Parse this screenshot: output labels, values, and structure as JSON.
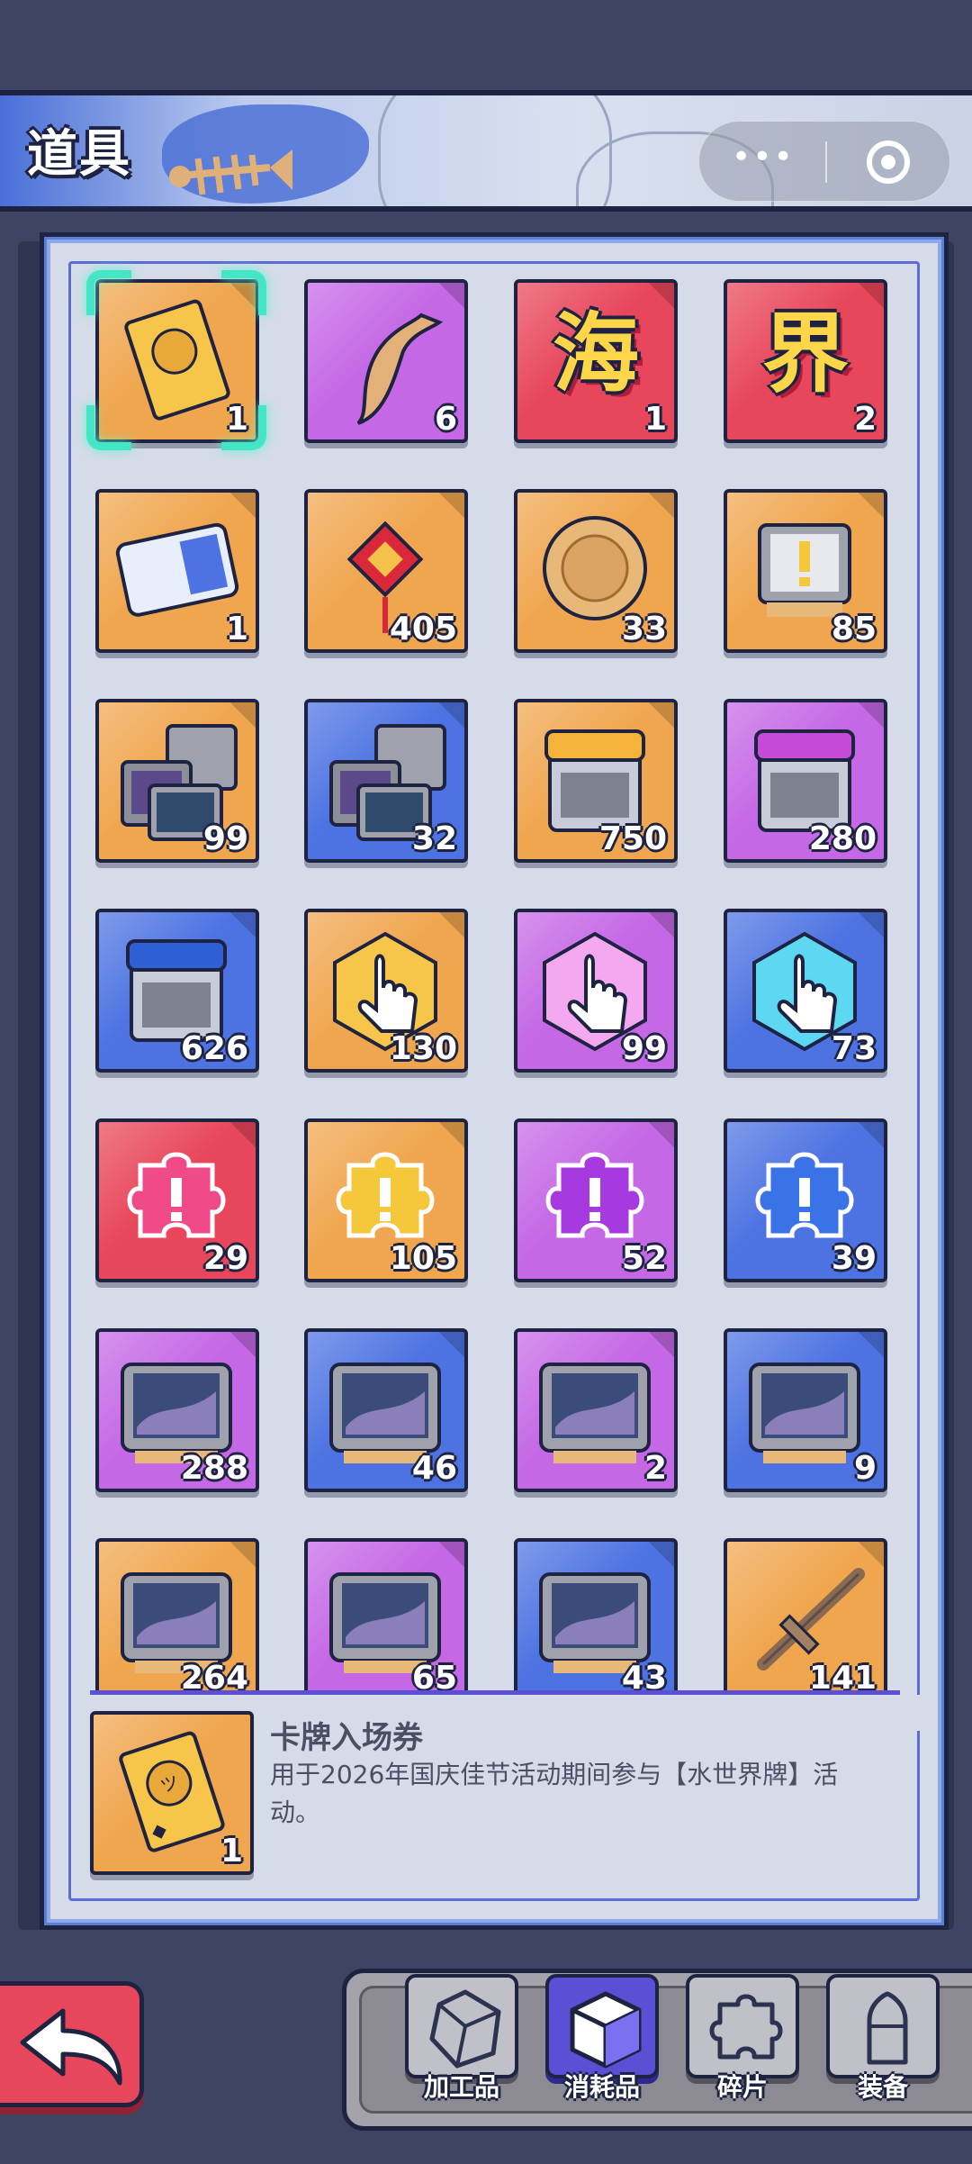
{
  "header": {
    "title": "道具"
  },
  "capsule": {
    "more_icon": "more-dots-icon",
    "close_icon": "target-circle-icon"
  },
  "items": [
    {
      "bg": "orange",
      "icon": "ticket-icon",
      "glyph": "",
      "count": "1"
    },
    {
      "bg": "purple",
      "icon": "claw-icon",
      "glyph": "",
      "count": "6"
    },
    {
      "bg": "red",
      "icon": "hai-character-icon",
      "glyph": "海",
      "count": "1"
    },
    {
      "bg": "red",
      "icon": "jie-character-icon",
      "glyph": "界",
      "count": "2"
    },
    {
      "bg": "orange",
      "icon": "coupon-icon",
      "glyph": "",
      "count": "1"
    },
    {
      "bg": "orange",
      "icon": "fortune-knot-icon",
      "glyph": "",
      "count": "405"
    },
    {
      "bg": "orange",
      "icon": "mooncake-icon",
      "glyph": "",
      "count": "33"
    },
    {
      "bg": "orange",
      "icon": "alert-screen-icon",
      "glyph": "",
      "count": "85"
    },
    {
      "bg": "orange",
      "icon": "card-pack-icon",
      "glyph": "",
      "count": "99"
    },
    {
      "bg": "blue",
      "icon": "card-pack-icon",
      "glyph": "",
      "count": "32"
    },
    {
      "bg": "orange",
      "icon": "crate-icon",
      "glyph": "",
      "count": "750"
    },
    {
      "bg": "purple",
      "icon": "crate-icon",
      "glyph": "",
      "count": "280"
    },
    {
      "bg": "blue",
      "icon": "crate-icon",
      "glyph": "",
      "count": "626"
    },
    {
      "bg": "orange",
      "icon": "tap-hand-icon",
      "glyph": "",
      "count": "130"
    },
    {
      "bg": "purple",
      "icon": "tap-hand-icon",
      "glyph": "",
      "count": "99"
    },
    {
      "bg": "blue",
      "icon": "tap-hand-icon",
      "glyph": "",
      "count": "73"
    },
    {
      "bg": "red",
      "icon": "puzzle-alert-icon",
      "glyph": "",
      "count": "29"
    },
    {
      "bg": "orange",
      "icon": "puzzle-alert-icon",
      "glyph": "",
      "count": "105"
    },
    {
      "bg": "purple",
      "icon": "puzzle-alert-icon",
      "glyph": "",
      "count": "52"
    },
    {
      "bg": "blue",
      "icon": "puzzle-alert-icon",
      "glyph": "",
      "count": "39"
    },
    {
      "bg": "purple",
      "icon": "creature-tv-icon",
      "glyph": "",
      "count": "288"
    },
    {
      "bg": "blue",
      "icon": "creature-tv-icon",
      "glyph": "",
      "count": "46"
    },
    {
      "bg": "purple",
      "icon": "creature-tv-icon",
      "glyph": "",
      "count": "2"
    },
    {
      "bg": "blue",
      "icon": "creature-tv-icon",
      "glyph": "",
      "count": "9"
    },
    {
      "bg": "orange",
      "icon": "creature-tv-icon",
      "glyph": "",
      "count": "264"
    },
    {
      "bg": "purple",
      "icon": "creature-tv-icon",
      "glyph": "",
      "count": "65"
    },
    {
      "bg": "blue",
      "icon": "creature-tv-icon",
      "glyph": "",
      "count": "43"
    },
    {
      "bg": "orange",
      "icon": "stick-icon",
      "glyph": "",
      "count": "141"
    }
  ],
  "detail": {
    "name": "卡牌入场券",
    "description": "用于2026年国庆佳节活动期间参与【水世界牌】活动。",
    "count": "1"
  },
  "nav": {
    "back_icon": "back-arrow-icon",
    "tabs": [
      {
        "label": "加工品",
        "icon": "crystal-icon"
      },
      {
        "label": "消耗品",
        "icon": "cube-icon"
      },
      {
        "label": "碎片",
        "icon": "puzzle-icon"
      },
      {
        "label": "装备",
        "icon": "bullet-icon"
      }
    ]
  }
}
